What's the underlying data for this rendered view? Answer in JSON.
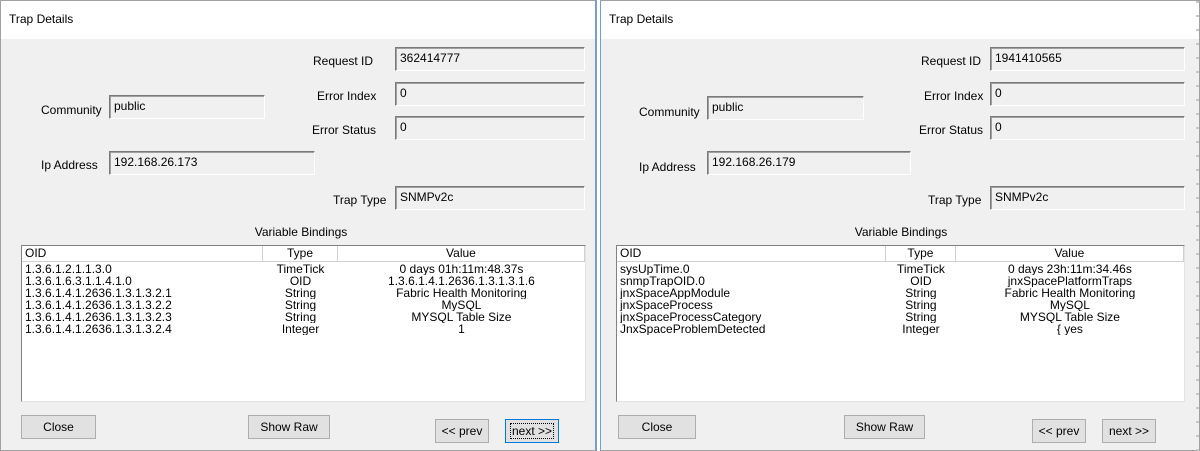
{
  "dialogs": [
    {
      "title": "Trap Details",
      "labels": {
        "request_id": "Request ID",
        "error_index": "Error Index",
        "error_status": "Error Status",
        "community": "Community",
        "ip_address": "Ip Address",
        "trap_type": "Trap Type",
        "variable_bindings": "Variable Bindings"
      },
      "values": {
        "request_id": "362414777",
        "error_index": "0",
        "error_status": "0",
        "community": "public",
        "ip_address": "192.168.26.173",
        "trap_type": "SNMPv2c"
      },
      "table": {
        "columns": [
          "OID",
          "Type",
          "Value"
        ],
        "rows": [
          {
            "oid": "1.3.6.1.2.1.1.3.0",
            "type": "TimeTick",
            "value": "0 days 01h:11m:48.37s"
          },
          {
            "oid": "1.3.6.1.6.3.1.1.4.1.0",
            "type": "OID",
            "value": "1.3.6.1.4.1.2636.1.3.1.3.1.6"
          },
          {
            "oid": "1.3.6.1.4.1.2636.1.3.1.3.2.1",
            "type": "String",
            "value": "Fabric Health Monitoring"
          },
          {
            "oid": "1.3.6.1.4.1.2636.1.3.1.3.2.2",
            "type": "String",
            "value": "MySQL"
          },
          {
            "oid": "1.3.6.1.4.1.2636.1.3.1.3.2.3",
            "type": "String",
            "value": "MYSQL Table Size"
          },
          {
            "oid": "1.3.6.1.4.1.2636.1.3.1.3.2.4",
            "type": "Integer",
            "value": "1"
          }
        ]
      },
      "buttons": {
        "close": "Close",
        "show_raw": "Show Raw",
        "prev": "<< prev",
        "next": "next >>"
      }
    },
    {
      "title": "Trap Details",
      "labels": {
        "request_id": "Request ID",
        "error_index": "Error Index",
        "error_status": "Error Status",
        "community": "Community",
        "ip_address": "Ip Address",
        "trap_type": "Trap Type",
        "variable_bindings": "Variable Bindings"
      },
      "values": {
        "request_id": "1941410565",
        "error_index": "0",
        "error_status": "0",
        "community": "public",
        "ip_address": "192.168.26.179",
        "trap_type": "SNMPv2c"
      },
      "table": {
        "columns": [
          "OID",
          "Type",
          "Value"
        ],
        "rows": [
          {
            "oid": "sysUpTime.0",
            "type": "TimeTick",
            "value": "0 days 23h:11m:34.46s"
          },
          {
            "oid": "snmpTrapOID.0",
            "type": "OID",
            "value": "jnxSpacePlatformTraps"
          },
          {
            "oid": "jnxSpaceAppModule",
            "type": "String",
            "value": "Fabric Health Monitoring"
          },
          {
            "oid": "jnxSpaceProcess",
            "type": "String",
            "value": "MySQL"
          },
          {
            "oid": "jnxSpaceProcessCategory",
            "type": "String",
            "value": "MYSQL Table Size"
          },
          {
            "oid": "JnxSpaceProblemDetected",
            "type": "Integer",
            "value": "{ yes"
          }
        ]
      },
      "buttons": {
        "close": "Close",
        "show_raw": "Show Raw",
        "prev": "<< prev",
        "next": "next >>"
      }
    }
  ]
}
